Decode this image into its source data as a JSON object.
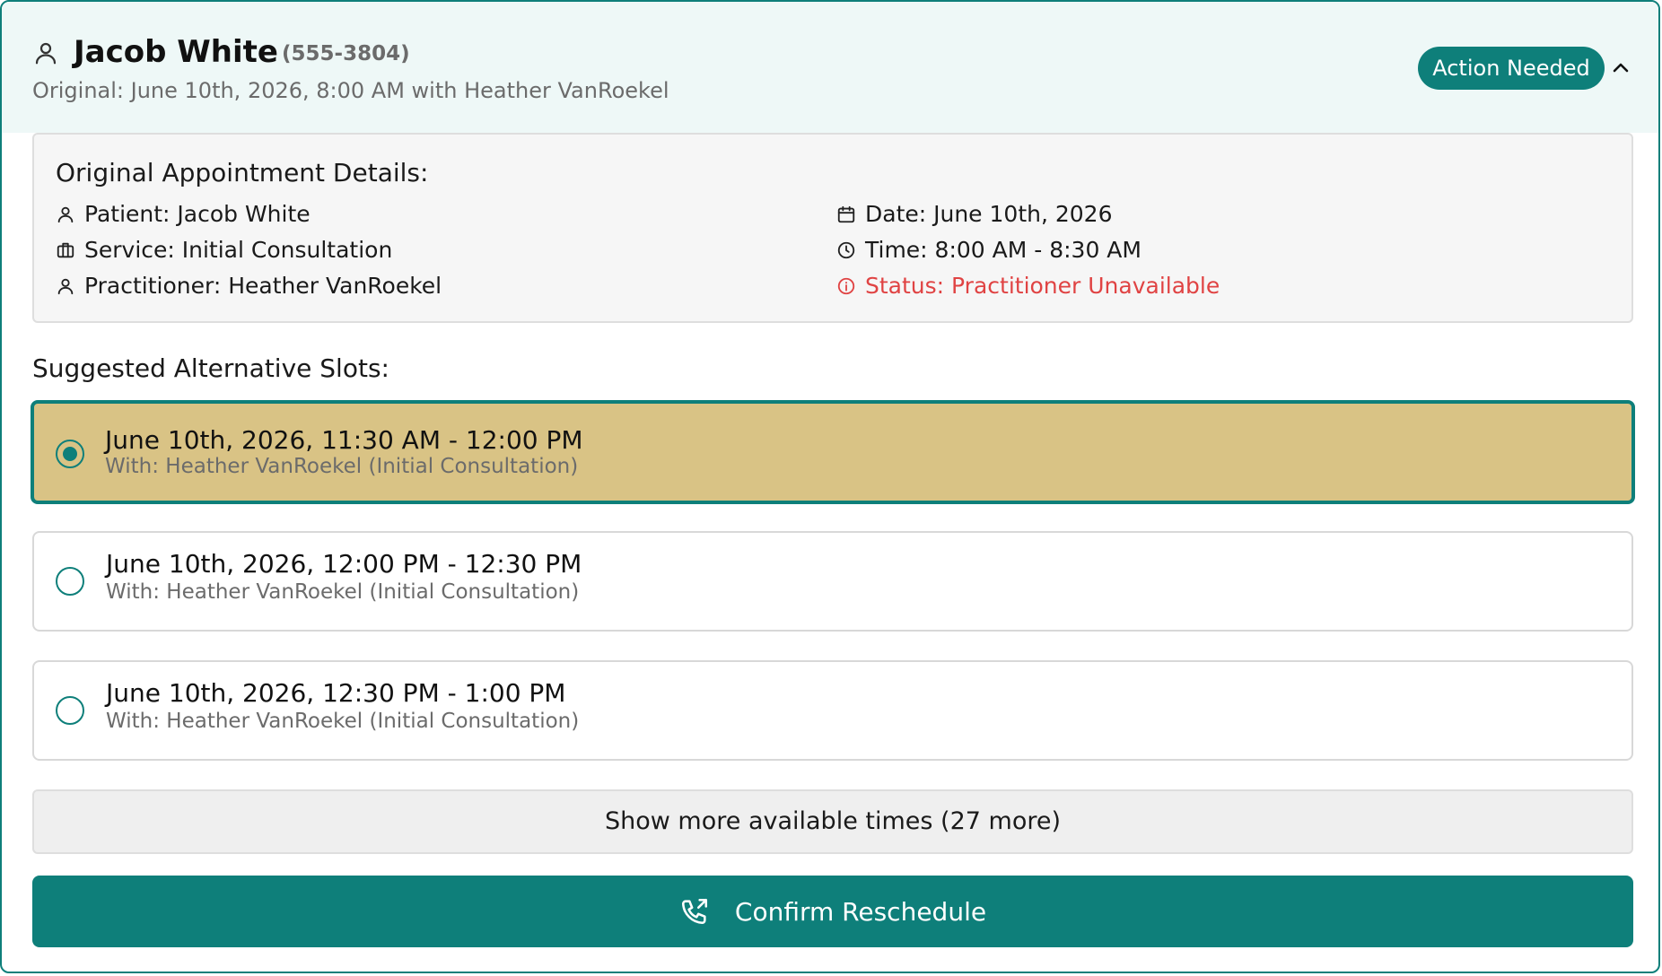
{
  "header": {
    "name": "Jacob White",
    "phone": "(555-3804)",
    "subtitle": "Original: June 10th, 2026, 8:00 AM with Heather VanRoekel",
    "badge": "Action Needed",
    "icons": {
      "person": "user-icon",
      "collapse": "chevron-up-icon"
    }
  },
  "details": {
    "title": "Original Appointment Details:",
    "patient": "Patient: Jacob White",
    "service": "Service: Initial Consultation",
    "practitioner": "Practitioner: Heather VanRoekel",
    "date": "Date: June 10th, 2026",
    "time": "Time: 8:00 AM - 8:30 AM",
    "status": "Status: Practitioner Unavailable"
  },
  "suggestions": {
    "title": "Suggested Alternative Slots:",
    "slots": [
      {
        "time": "June 10th, 2026, 11:30 AM - 12:00 PM",
        "with": "With: Heather VanRoekel (Initial Consultation)",
        "selected": true
      },
      {
        "time": "June 10th, 2026, 12:00 PM - 12:30 PM",
        "with": "With: Heather VanRoekel (Initial Consultation)",
        "selected": false
      },
      {
        "time": "June 10th, 2026, 12:30 PM - 1:00 PM",
        "with": "With: Heather VanRoekel (Initial Consultation)",
        "selected": false
      }
    ]
  },
  "actions": {
    "show_more": "Show more available times (27 more)",
    "confirm": "Confirm Reschedule"
  },
  "colors": {
    "accent": "#0e7f7a",
    "selected_bg": "#d9c385",
    "error": "#e04343",
    "header_bg": "#eef8f7"
  }
}
